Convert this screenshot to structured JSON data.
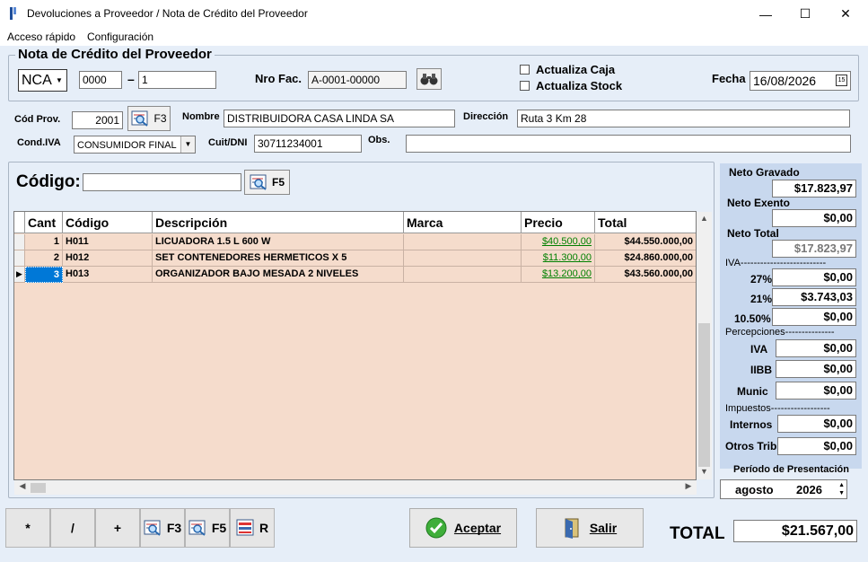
{
  "window": {
    "title": "Devoluciones a Proveedor / Nota de Crédito del Proveedor",
    "minimize": "—",
    "maximize": "☐",
    "close": "✕"
  },
  "menu": {
    "items": [
      {
        "label": "Acceso rápido"
      },
      {
        "label": "Configuración"
      }
    ]
  },
  "header": {
    "group_title": "Nota de Crédito del Proveedor",
    "doc_type": "NCA",
    "punto_venta": "0000",
    "separator": "–",
    "numero": "1",
    "nro_fac_label": "Nro Fac.",
    "nro_fac": "A-0001-00000",
    "actualiza_caja": "Actualiza Caja",
    "actualiza_stock": "Actualiza Stock",
    "fecha_label": "Fecha",
    "fecha": "16/08/2026",
    "calendar_icon_text": "15"
  },
  "proveedor": {
    "cod_label": "Cód Prov.",
    "cod": "2001",
    "f3_label": "F3",
    "nombre_label": "Nombre",
    "nombre": "DISTRIBUIDORA CASA LINDA SA",
    "direccion_label": "Dirección",
    "direccion": "Ruta 3 Km 28",
    "cond_iva_label": "Cond.IVA",
    "cond_iva": "CONSUMIDOR FINAL",
    "cuit_label": "Cuit/DNI",
    "cuit": "30711234001",
    "obs_label": "Obs.",
    "obs": ""
  },
  "codigo": {
    "label": "Código:",
    "value": "",
    "f5_label": "F5"
  },
  "grid": {
    "columns": [
      "Cant",
      "Código",
      "Descripción",
      "Marca",
      "Precio",
      "Total"
    ],
    "rows": [
      {
        "cant": "1",
        "codigo": "H011",
        "descripcion": "LICUADORA 1.5 L 600 W",
        "marca": "",
        "precio": "$40.500,00",
        "total": "$44.550.000,00"
      },
      {
        "cant": "2",
        "codigo": "H012",
        "descripcion": "SET CONTENEDORES HERMETICOS X 5",
        "marca": "",
        "precio": "$11.300,00",
        "total": "$24.860.000,00"
      },
      {
        "cant": "3",
        "codigo": "H013",
        "descripcion": "ORGANIZADOR BAJO MESADA 2 NIVELES",
        "marca": "",
        "precio": "$13.200,00",
        "total": "$43.560.000,00"
      }
    ]
  },
  "totals": {
    "neto_gravado_label": "Neto Gravado",
    "neto_gravado": "$17.823,97",
    "neto_exento_label": "Neto Exento",
    "neto_exento": "$0,00",
    "neto_total_label": "Neto Total",
    "neto_total": "$17.823,97",
    "iva_label": "IVA--------------------------",
    "iva_27_label": "27%",
    "iva_27": "$0,00",
    "iva_21_label": "21%",
    "iva_21": "$3.743,03",
    "iva_105_label": "10.50%",
    "iva_105": "$0,00",
    "percepciones_label": "Percepciones---------------",
    "perc_iva_label": "IVA",
    "perc_iva": "$0,00",
    "perc_iibb_label": "IIBB",
    "perc_iibb": "$0,00",
    "perc_munic_label": "Munic",
    "perc_munic": "$0,00",
    "impuestos_label": "Impuestos------------------",
    "internos_label": "Internos",
    "internos": "$0,00",
    "otros_label": "Otros Trib",
    "otros": "$0,00",
    "periodo_label": "Período de Presentación",
    "periodo_mes": "agosto",
    "periodo_anio": "2026"
  },
  "bottom": {
    "btn_mult": "*",
    "btn_div": "/",
    "btn_plus": "+",
    "btn_f3": "F3",
    "btn_f5": "F5",
    "btn_r": "R",
    "aceptar": "Aceptar",
    "salir": "Salir",
    "total_label": "TOTAL",
    "total": "$21.567,00"
  },
  "colors": {
    "background": "#e6eef8",
    "grid_bg": "#f5dccc",
    "right_panel": "#c8d8ee",
    "price_link": "#008000",
    "selection": "#0078d7"
  }
}
